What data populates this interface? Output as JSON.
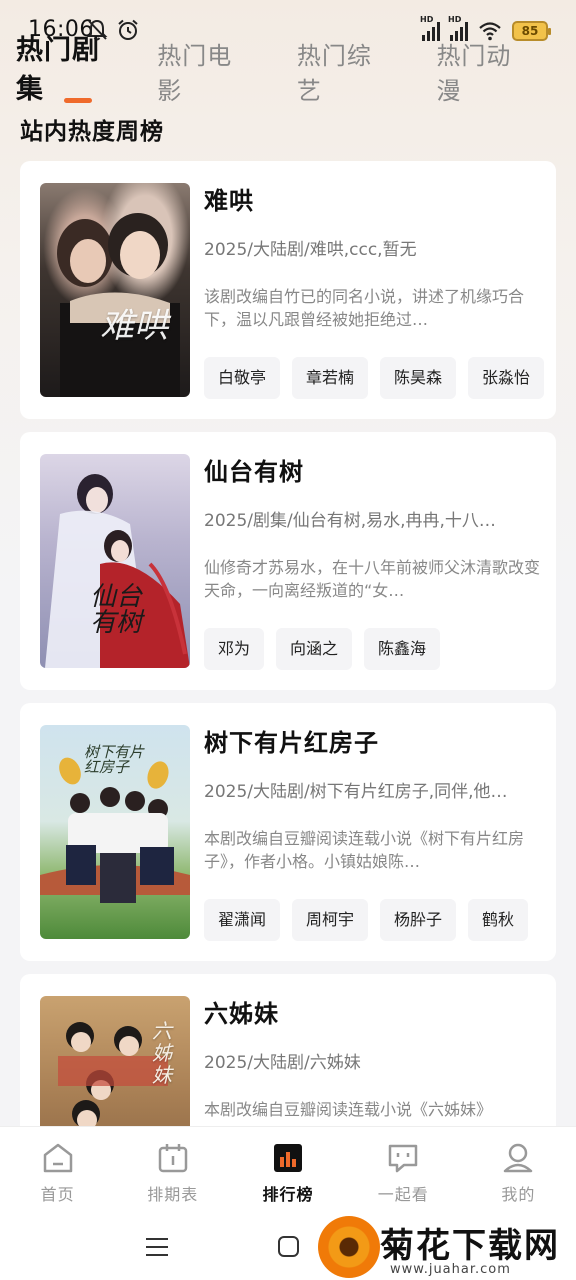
{
  "status_bar": {
    "time": "16:06",
    "battery": "85",
    "hd1": "HD",
    "hd2": "HD"
  },
  "top_tabs": [
    "热门剧集",
    "热门电影",
    "热门综艺",
    "热门动漫"
  ],
  "section_title": "站内热度周榜",
  "cards": [
    {
      "title": "难哄",
      "meta": "2025/大陆剧/难哄,ccc,暂无",
      "desc": "该剧改编自竹已的同名小说，讲述了机缘巧合下，温以凡跟曾经被她拒绝过…",
      "tags": [
        "白敬亭",
        "章若楠",
        "陈昊森",
        "张淼怡"
      ],
      "poster_text": "难哄"
    },
    {
      "title": "仙台有树",
      "meta": "2025/剧集/仙台有树,易水,冉冉,十八…",
      "desc": "仙修奇才苏易水，在十八年前被师父沐清歌改变天命，一向离经叛道的“女…",
      "tags": [
        "邓为",
        "向涵之",
        "陈鑫海"
      ],
      "poster_text": "仙台有树"
    },
    {
      "title": "树下有片红房子",
      "meta": "2025/大陆剧/树下有片红房子,同伴,他…",
      "desc": "本剧改编自豆瓣阅读连载小说《树下有片红房子》，作者小格。小镇姑娘陈…",
      "tags": [
        "翟潇闻",
        "周柯宇",
        "杨肸子",
        "鹤秋"
      ],
      "poster_text": "树下有片红房子"
    },
    {
      "title": "六姊妹",
      "meta": "2025/大陆剧/六姊妹",
      "desc": "本剧改编自豆瓣阅读连载小说《六姊妹》",
      "tags": [],
      "poster_text": "六姊妹"
    }
  ],
  "bottom_nav": [
    {
      "label": "首页",
      "icon": "home-icon"
    },
    {
      "label": "排期表",
      "icon": "calendar-icon"
    },
    {
      "label": "排行榜",
      "icon": "ranking-icon",
      "active": true
    },
    {
      "label": "一起看",
      "icon": "chat-icon"
    },
    {
      "label": "我的",
      "icon": "profile-icon"
    }
  ],
  "watermark": {
    "text": "菊花下载网",
    "url": "www.juahar.com"
  },
  "colors": {
    "accent": "#ef6a2b",
    "text": "#111111",
    "muted": "#888888"
  }
}
